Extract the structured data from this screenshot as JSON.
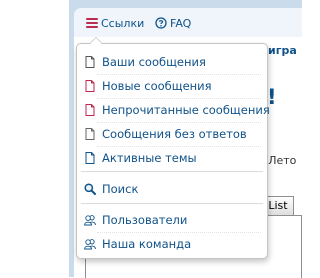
{
  "navbar": {
    "links_label": "Ссылки",
    "faq_label": "FAQ"
  },
  "background": {
    "nav_right_fragment": "игра",
    "heading_fragment": "!",
    "dateline_fragment": ": Лето",
    "list_button_fragment": "List"
  },
  "dropdown": {
    "items": [
      {
        "label": "Ваши сообщения",
        "icon": "document-icon"
      },
      {
        "label": "Новые сообщения",
        "icon": "document-new-icon"
      },
      {
        "label": "Непрочитанные сообщения",
        "icon": "document-unread-icon"
      },
      {
        "label": "Сообщения без ответов",
        "icon": "document-icon"
      },
      {
        "label": "Активные темы",
        "icon": "document-blue-icon"
      },
      {
        "label": "Поиск",
        "icon": "search-icon"
      },
      {
        "label": "Пользователи",
        "icon": "users-icon"
      },
      {
        "label": "Наша команда",
        "icon": "team-icon"
      }
    ]
  },
  "colors": {
    "link": "#105289",
    "accent": "#bc2a4d",
    "frame": "#cadceb",
    "navbar_bg": "#eff5fa"
  }
}
